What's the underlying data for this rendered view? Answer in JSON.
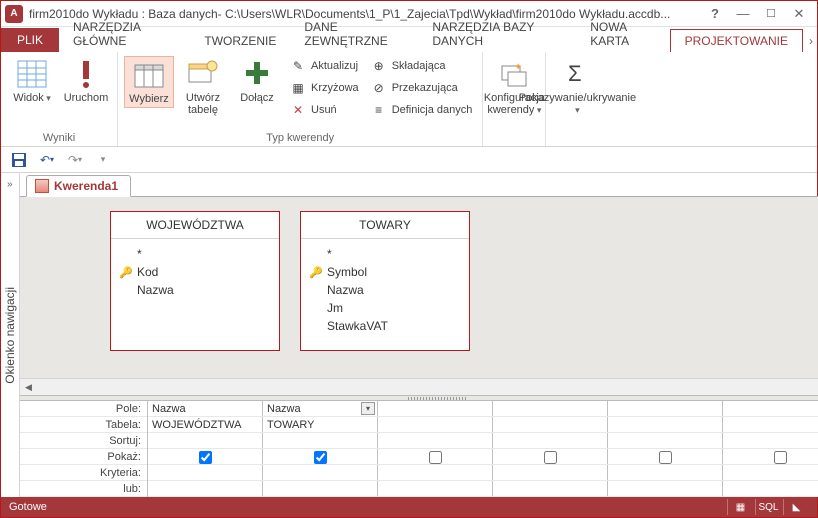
{
  "titlebar": {
    "title": "firm2010do Wykładu : Baza danych- C:\\Users\\WLR\\Documents\\1_P\\1_Zajecia\\Tpd\\Wykład\\firm2010do Wykładu.accdb..."
  },
  "ribbon_tabs": {
    "file": "PLIK",
    "home": "NARZĘDZIA GŁÓWNE",
    "create": "TWORZENIE",
    "external": "DANE ZEWNĘTRZNE",
    "dbtools": "NARZĘDZIA BAZY DANYCH",
    "newtab": "Nowa karta",
    "design": "PROJEKTOWANIE"
  },
  "ribbon": {
    "group_results": "Wyniki",
    "view": "Widok",
    "run": "Uruchom",
    "group_querytype": "Typ kwerendy",
    "select": "Wybierz",
    "maketable": "Utwórz tabelę",
    "append": "Dołącz",
    "update": "Aktualizuj",
    "crosstab": "Krzyżowa",
    "delete": "Usuń",
    "union": "Składająca",
    "passthrough": "Przekazująca",
    "datadef": "Definicja danych",
    "config": "Konfiguracja kwerendy",
    "showhide": "Pokazywanie/ukrywanie"
  },
  "nav_pane_label": "Okienko nawigacji",
  "doc_tab": "Kwerenda1",
  "tables": {
    "t1": {
      "title": "WOJEWÓDZTWA",
      "star": "*",
      "fields": [
        "Kod",
        "Nazwa"
      ],
      "key_index": 0
    },
    "t2": {
      "title": "TOWARY",
      "star": "*",
      "fields": [
        "Symbol",
        "Nazwa",
        "Jm",
        "StawkaVAT"
      ],
      "key_index": 0
    }
  },
  "grid": {
    "labels": {
      "pole": "Pole:",
      "tabela": "Tabela:",
      "sortuj": "Sortuj:",
      "pokaz": "Pokaż:",
      "kryteria": "Kryteria:",
      "lub": "lub:"
    },
    "cols": [
      {
        "pole": "Nazwa",
        "tabela": "WOJEWÓDZTWA",
        "pokaz": true
      },
      {
        "pole": "Nazwa",
        "tabela": "TOWARY",
        "pokaz": true,
        "dropdown": true
      },
      {
        "pole": "",
        "tabela": "",
        "pokaz": false
      },
      {
        "pole": "",
        "tabela": "",
        "pokaz": false
      },
      {
        "pole": "",
        "tabela": "",
        "pokaz": false
      },
      {
        "pole": "",
        "tabela": "",
        "pokaz": false
      }
    ]
  },
  "statusbar": {
    "ready": "Gotowe",
    "sql": "SQL"
  }
}
